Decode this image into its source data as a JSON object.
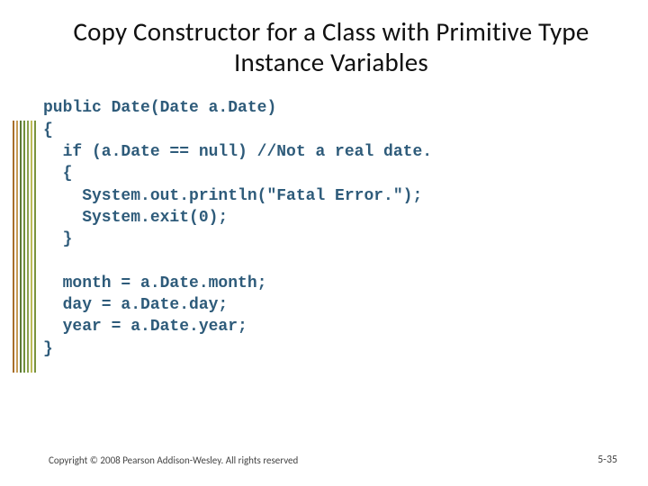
{
  "title": "Copy Constructor for a Class with Primitive Type Instance Variables",
  "code": "public Date(Date a.Date)\n{\n  if (a.Date == null) //Not a real date.\n  {\n    System.out.println(\"Fatal Error.\");\n    System.exit(0);\n  }\n\n  month = a.Date.month;\n  day = a.Date.day;\n  year = a.Date.year;\n}",
  "footer": "Copyright © 2008 Pearson Addison-Wesley. All rights reserved",
  "page_number": "5-35"
}
